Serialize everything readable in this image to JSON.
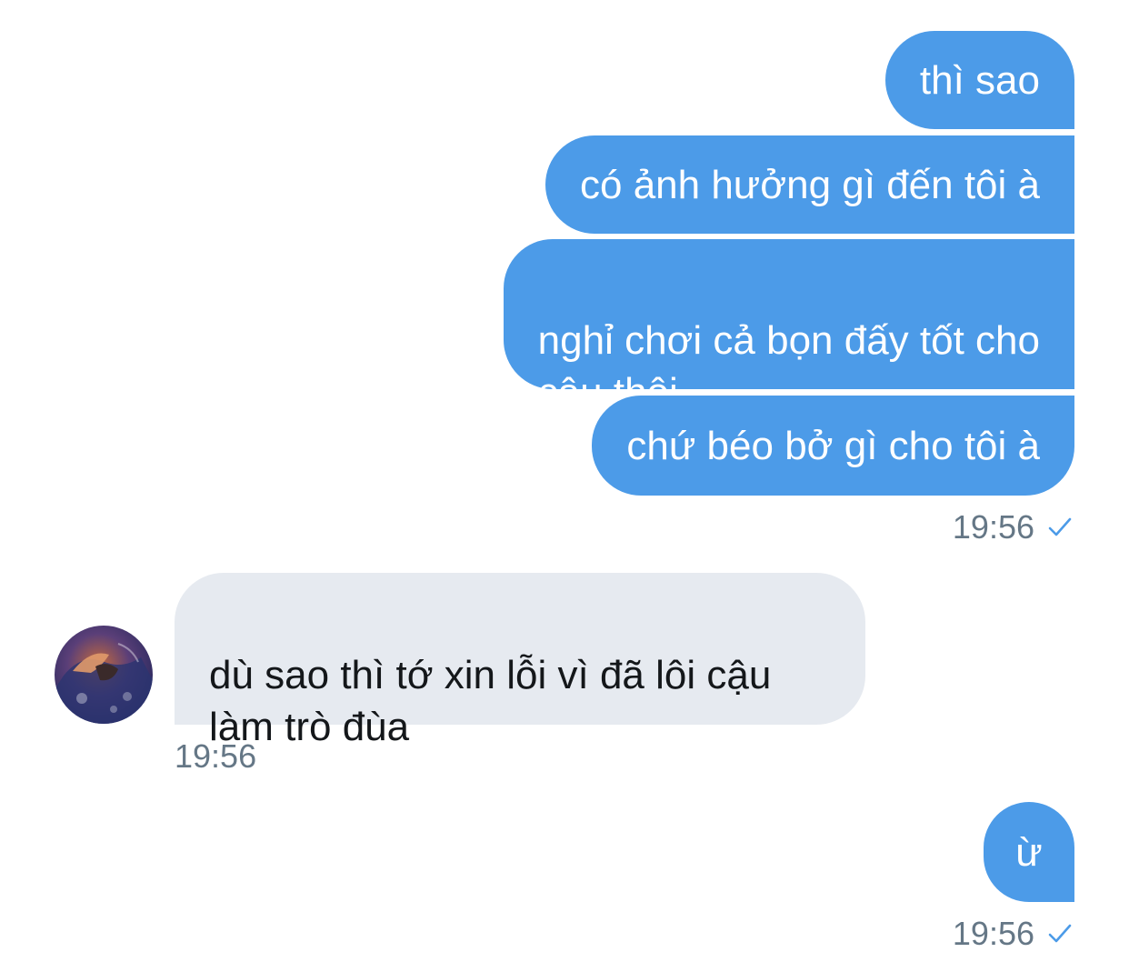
{
  "conversation": {
    "messages": [
      {
        "text": "thì sao",
        "direction": "outgoing"
      },
      {
        "text": "có ảnh hưởng gì đến tôi à",
        "direction": "outgoing"
      },
      {
        "text": "nghỉ chơi cả bọn đấy tốt cho\ncậu thôi",
        "direction": "outgoing"
      },
      {
        "text": "chứ béo bở gì cho tôi à",
        "direction": "outgoing"
      },
      {
        "text": "dù sao thì tớ xin lỗi vì đã lôi cậu\nlàm trò đùa",
        "direction": "incoming"
      },
      {
        "text": "ừ",
        "direction": "outgoing"
      }
    ],
    "timestamps": {
      "group1": "19:56",
      "incoming": "19:56",
      "group2": "19:56"
    },
    "icons": {
      "read_receipt": "check-icon",
      "avatar": "user-avatar"
    },
    "colors": {
      "outgoing_bubble": "#4c9be8",
      "incoming_bubble": "#e6eaf0",
      "timestamp": "#657786",
      "check": "#4c9be8"
    }
  }
}
